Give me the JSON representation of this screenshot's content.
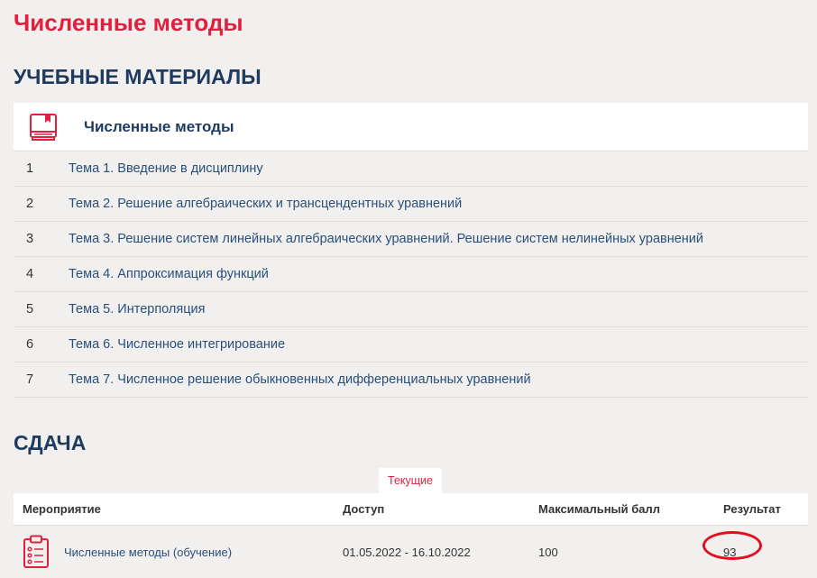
{
  "course_title": "Численные методы",
  "materials": {
    "section_title": "УЧЕБНЫЕ МАТЕРИАЛЫ",
    "header_label": "Численные методы",
    "topics": [
      {
        "num": "1",
        "title": "Тема 1. Введение в дисциплину"
      },
      {
        "num": "2",
        "title": "Тема 2. Решение алгебраических и трансцендентных уравнений"
      },
      {
        "num": "3",
        "title": "Тема 3. Решение систем линейных алгебраических уравнений. Решение систем нелинейных уравнений"
      },
      {
        "num": "4",
        "title": "Тема 4. Аппроксимация функций"
      },
      {
        "num": "5",
        "title": "Тема 5. Интерполяция"
      },
      {
        "num": "6",
        "title": "Тема 6. Численное интегрирование"
      },
      {
        "num": "7",
        "title": "Тема 7. Численное решение обыкновенных дифференциальных уравнений"
      }
    ]
  },
  "exams": {
    "section_title": "СДАЧА",
    "tab_current": "Текущие",
    "columns": {
      "event": "Мероприятие",
      "access": "Доступ",
      "max_score": "Максимальный балл",
      "result": "Результат"
    },
    "rows": [
      {
        "event": "Численные методы (обучение)",
        "access": "01.05.2022 - 16.10.2022",
        "max_score": "100",
        "result": "93"
      }
    ]
  },
  "colors": {
    "accent_red": "#e0203f",
    "heading_navy": "#1e3a5f",
    "link_blue": "#2a4f7a",
    "annotation_circle": "#e0101f"
  },
  "icons": {
    "materials_header": "book-icon",
    "exam_row": "clipboard-icon"
  }
}
